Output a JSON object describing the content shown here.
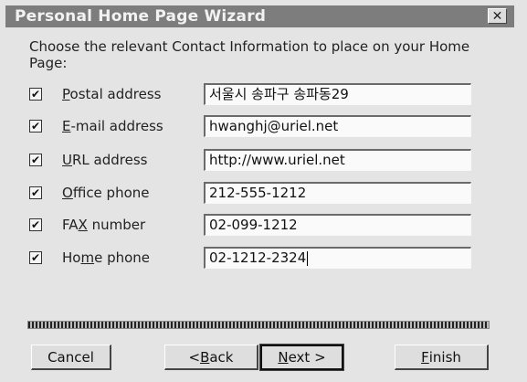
{
  "window": {
    "title": "Personal Home Page Wizard",
    "close_glyph": "✕"
  },
  "instructions": "Choose the relevant Contact Information to place on your Home Page:",
  "fields": [
    {
      "label_pre": "",
      "label_key": "P",
      "label_post": "ostal address",
      "checked": true,
      "value": "서울시 송파구 송파동29"
    },
    {
      "label_pre": "",
      "label_key": "E",
      "label_post": "-mail address",
      "checked": true,
      "value": "hwanghj@uriel.net"
    },
    {
      "label_pre": "",
      "label_key": "U",
      "label_post": "RL address",
      "checked": true,
      "value": "http://www.uriel.net"
    },
    {
      "label_pre": "",
      "label_key": "O",
      "label_post": "ffice phone",
      "checked": true,
      "value": "212-555-1212"
    },
    {
      "label_pre": "FA",
      "label_key": "X",
      "label_post": " number",
      "checked": true,
      "value": "02-099-1212"
    },
    {
      "label_pre": "Ho",
      "label_key": "m",
      "label_post": "e phone",
      "checked": true,
      "value": "02-1212-2324"
    }
  ],
  "checkmark": "✔",
  "progress": {
    "fraction": 1.0
  },
  "buttons": {
    "cancel": {
      "label": "Cancel"
    },
    "back": {
      "pre": "< ",
      "key": "B",
      "post": "ack"
    },
    "next": {
      "pre": "",
      "key": "N",
      "post": "ext >"
    },
    "finish": {
      "pre": "",
      "key": "F",
      "post": "inish"
    }
  }
}
